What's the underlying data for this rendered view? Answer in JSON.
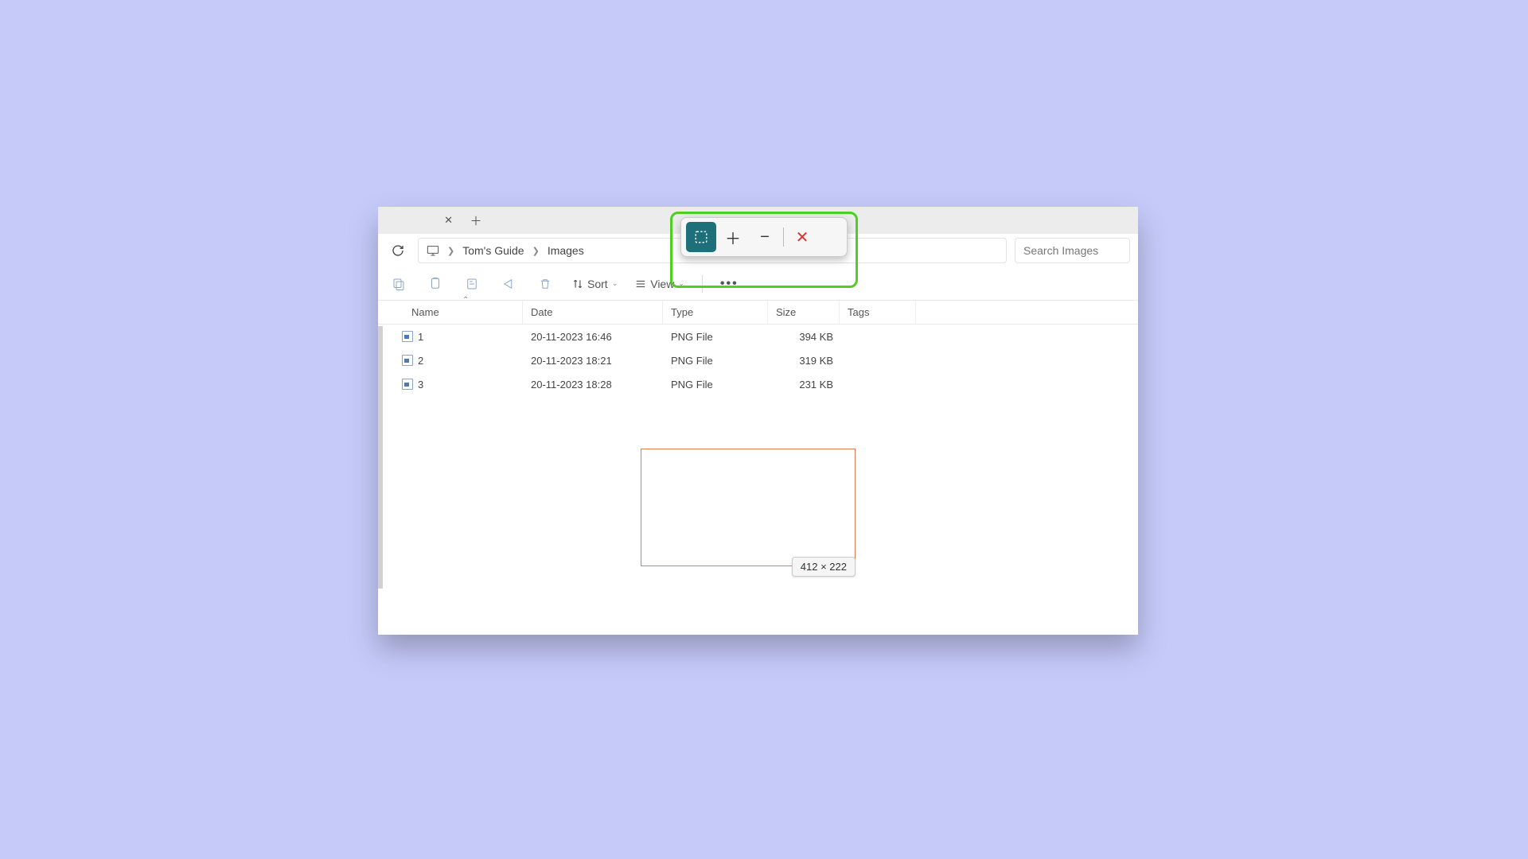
{
  "breadcrumb": {
    "part1": "Tom's Guide",
    "part2": "Images"
  },
  "search": {
    "placeholder": "Search Images"
  },
  "toolbar": {
    "sort_label": "Sort",
    "view_label": "View"
  },
  "columns": {
    "name": "Name",
    "date": "Date",
    "type": "Type",
    "size": "Size",
    "tags": "Tags"
  },
  "files": [
    {
      "name": "1",
      "date": "20-11-2023 16:46",
      "type": "PNG File",
      "size": "394 KB"
    },
    {
      "name": "2",
      "date": "20-11-2023 18:21",
      "type": "PNG File",
      "size": "319 KB"
    },
    {
      "name": "3",
      "date": "20-11-2023 18:28",
      "type": "PNG File",
      "size": "231 KB"
    }
  ],
  "selection": {
    "dimensions": "412 × 222"
  }
}
